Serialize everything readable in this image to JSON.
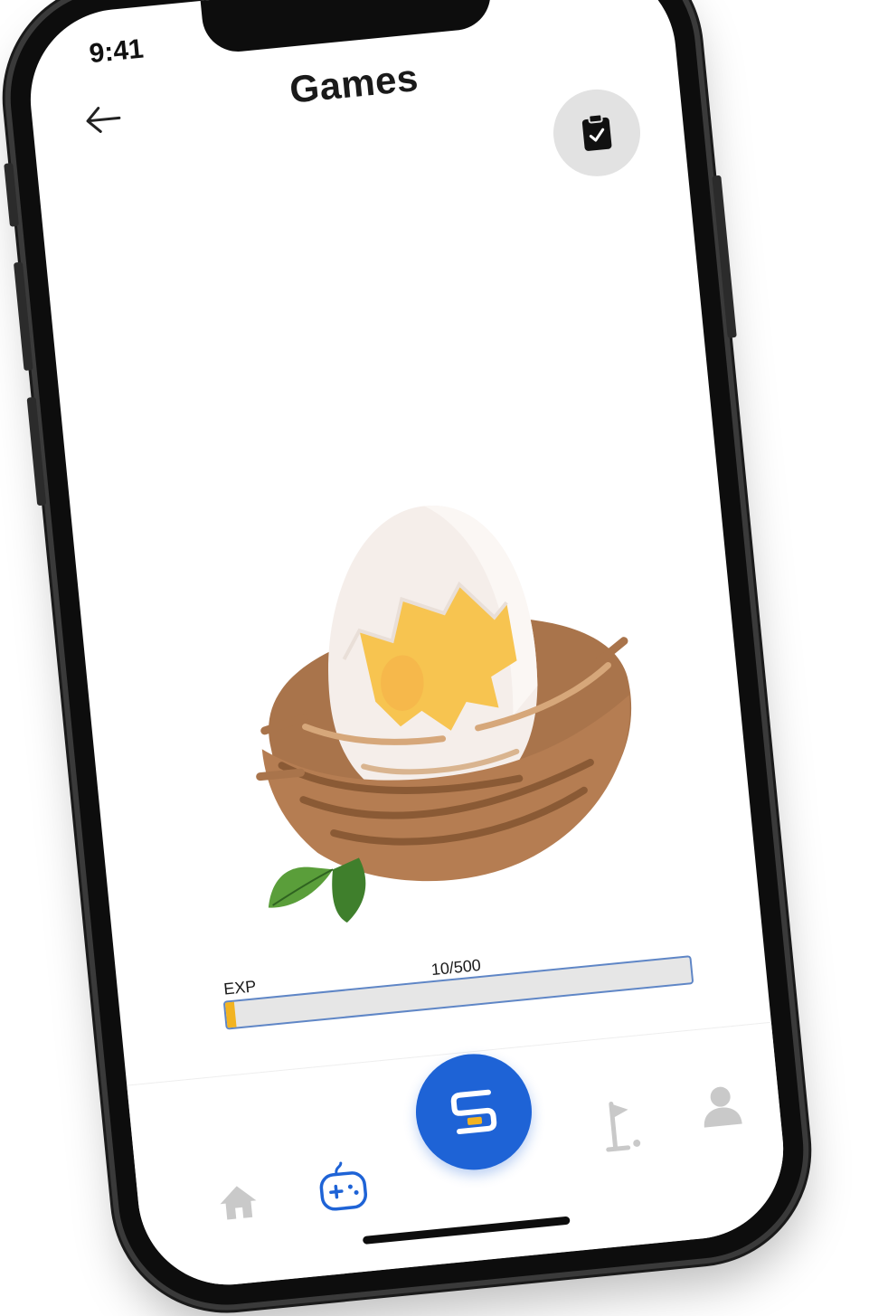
{
  "status_bar": {
    "time": "9:41"
  },
  "header": {
    "title": "Games"
  },
  "icons": {
    "back": "arrow-left-icon",
    "quests": "clipboard-check-icon",
    "home": "home-icon",
    "games": "gamepad-icon",
    "center": "s-logo-icon",
    "golf": "golf-flag-icon",
    "profile": "user-icon"
  },
  "pet": {
    "image": "egg-in-nest"
  },
  "exp": {
    "label": "EXP",
    "value_text": "10/500",
    "current": 10,
    "max": 500
  },
  "colors": {
    "accent": "#1e63d6",
    "exp_fill": "#f2b321",
    "exp_border": "#5f86c6"
  }
}
